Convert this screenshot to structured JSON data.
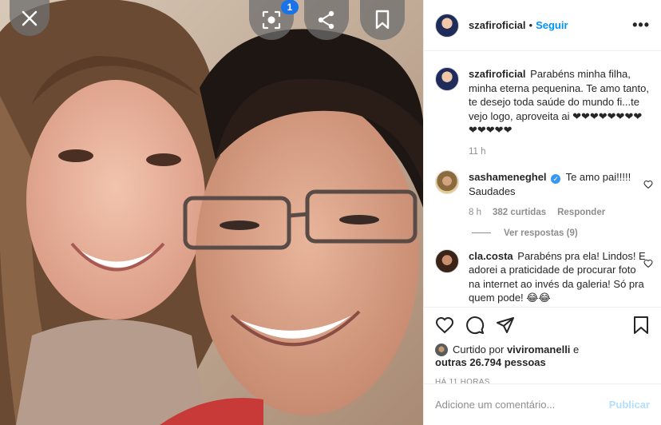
{
  "post": {
    "username": "szafiroficial",
    "follow_label": "Seguir",
    "separator": "•",
    "more_label": "•••"
  },
  "overlay": {
    "badge_count": "1"
  },
  "caption": {
    "username": "szafiroficial",
    "text": "Parabéns minha filha, minha eterna pequenina. Te amo tanto, te desejo toda saúde do mundo fi...te vejo logo, aproveita ai ❤❤❤❤❤❤❤❤❤❤❤❤❤",
    "time": "11 h"
  },
  "comments": [
    {
      "username": "sashameneghel",
      "text": "Te amo pai!!!!! Saudades",
      "time": "8 h",
      "likes": "382 curtidas",
      "reply": "Responder"
    },
    {
      "username": "cla.costa",
      "text": "Parabéns pra ela! Lindos! E adorei a praticidade de procurar foto na internet ao invés da galeria! Só pra quem pode! 😂😂"
    }
  ],
  "view_replies": "Ver respostas (9)",
  "likes": {
    "prefix": "Curtido por",
    "user": "viviromanelli",
    "suffix": "e",
    "others": "outras 26.794 pessoas"
  },
  "timestamp": "HÁ 11 HORAS",
  "comment_box": {
    "placeholder": "Adicione um comentário...",
    "publish": "Publicar"
  },
  "colors": {
    "accent": "#0095f6",
    "publish_disabled": "#b2dffc",
    "muted": "#8e8e8e"
  }
}
